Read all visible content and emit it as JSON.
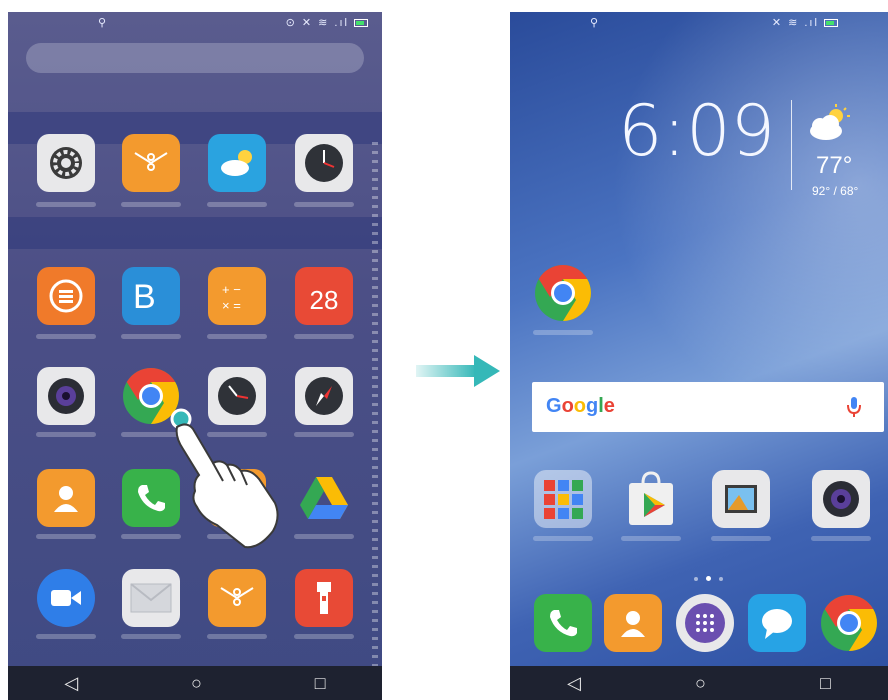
{
  "left_screen": {
    "calendar_day": "28"
  },
  "right_screen": {
    "clock_time": "6:09",
    "weather_temp": "77°",
    "weather_range": "92° / 68°",
    "search_brand": "Google"
  },
  "colors": {
    "google_blue": "#4285f4",
    "google_red": "#ea4335",
    "google_yellow": "#fbbc05",
    "google_green": "#34a853",
    "arrow_teal": "#35b8b8"
  }
}
